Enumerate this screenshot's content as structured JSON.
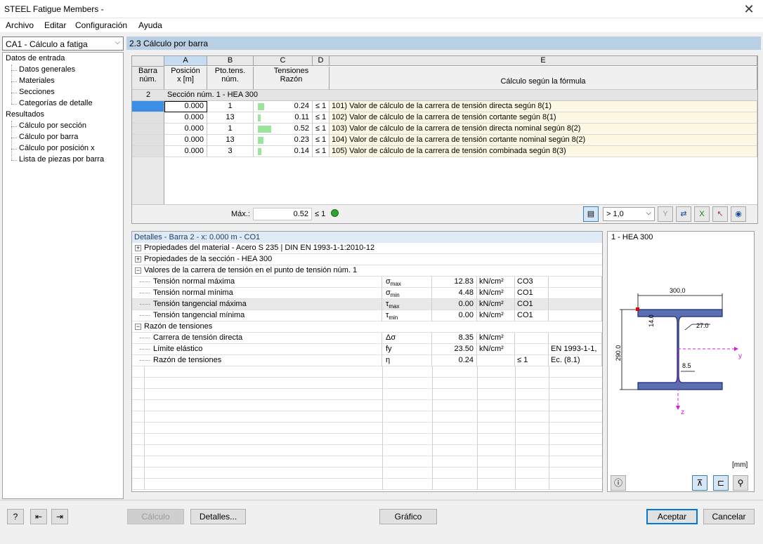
{
  "window": {
    "title": "STEEL Fatigue Members -",
    "close": "✕"
  },
  "menu": [
    "Archivo",
    "Editar",
    "Configuración",
    "Ayuda"
  ],
  "case_select": "CA1 - Cálculo a fatiga",
  "tree": {
    "input_group": "Datos de entrada",
    "input_items": [
      "Datos generales",
      "Materiales",
      "Secciones",
      "Categorías de detalle"
    ],
    "results_group": "Resultados",
    "results_items": [
      "Cálculo por sección",
      "Cálculo por barra",
      "Cálculo por posición x",
      "Lista de piezas por barra"
    ]
  },
  "panel_title": "2.3 Cálculo por barra",
  "grid": {
    "col_letters": [
      "A",
      "B",
      "C",
      "D",
      "E"
    ],
    "h_barra": [
      "Barra",
      "núm."
    ],
    "h_a": [
      "Posición",
      "x [m]"
    ],
    "h_b": [
      "Pto.tens.",
      "núm."
    ],
    "h_c": [
      "Tensiones",
      "Razón"
    ],
    "h_e": "Cálculo según la fórmula",
    "group_bar": "2",
    "group_label": "Sección núm.  1 - HEA 300",
    "rows": [
      {
        "x": "0.000",
        "pt": "1",
        "ratio": "0.24",
        "ratio_val": 0.24,
        "le": "≤ 1",
        "formula": "101) Valor de cálculo de la carrera de tensión directa según 8(1)"
      },
      {
        "x": "0.000",
        "pt": "13",
        "ratio": "0.11",
        "ratio_val": 0.11,
        "le": "≤ 1",
        "formula": "102) Valor de cálculo de la carrera de tensión cortante según 8(1)"
      },
      {
        "x": "0.000",
        "pt": "1",
        "ratio": "0.52",
        "ratio_val": 0.52,
        "le": "≤ 1",
        "formula": "103) Valor de cálculo de la carrera de tensión directa nominal según 8(2)"
      },
      {
        "x": "0.000",
        "pt": "13",
        "ratio": "0.23",
        "ratio_val": 0.23,
        "le": "≤ 1",
        "formula": "104) Valor de cálculo de la carrera de tensión cortante nominal según 8(2)"
      },
      {
        "x": "0.000",
        "pt": "3",
        "ratio": "0.14",
        "ratio_val": 0.14,
        "le": "≤ 1",
        "formula": "105) Valor de cálculo de la carrera de tensión combinada según 8(3)"
      }
    ],
    "max_label": "Máx.:",
    "max_value": "0.52",
    "max_le": "≤ 1",
    "filter_value": "> 1,0"
  },
  "details": {
    "title": "Detalles - Barra 2 - x: 0.000 m - CO1",
    "sec1": "Propiedades del material - Acero S 235 | DIN EN 1993-1-1:2010-12",
    "sec2": "Propiedades de la sección  -  HEA 300",
    "sec3": "Valores de la carrera de tensión en el punto de tensión núm. 1",
    "stress_rows": [
      {
        "name": "Tensión normal máxima",
        "sym": "σ",
        "sub": "max",
        "val": "12.83",
        "unit": "kN/cm²",
        "co": "CO3"
      },
      {
        "name": "Tensión normal mínima",
        "sym": "σ",
        "sub": "min",
        "val": "4.48",
        "unit": "kN/cm²",
        "co": "CO1"
      },
      {
        "name": "Tensión tangencial máxima",
        "sym": "τ",
        "sub": "max",
        "val": "0.00",
        "unit": "kN/cm²",
        "co": "CO1"
      },
      {
        "name": "Tensión tangencial mínima",
        "sym": "τ",
        "sub": "min",
        "val": "0.00",
        "unit": "kN/cm²",
        "co": "CO1"
      }
    ],
    "sec4": "Razón de tensiones",
    "ratio_rows": [
      {
        "name": "Carrera de tensión directa",
        "sym": "Δσ",
        "val": "8.35",
        "unit": "kN/cm²",
        "le": "",
        "ref": ""
      },
      {
        "name": "Límite elástico",
        "sym": "fy",
        "val": "23.50",
        "unit": "kN/cm²",
        "le": "",
        "ref": "EN 1993-1-1,"
      },
      {
        "name": "Razón de tensiones",
        "sym": "η",
        "val": "0.24",
        "unit": "",
        "le": "≤ 1",
        "ref": "Ec. (8.1)"
      }
    ]
  },
  "section_view": {
    "title": "1 - HEA 300",
    "dim_b": "300.0",
    "dim_h": "290.0",
    "dim_tf": "14.0",
    "dim_r": "27.0",
    "dim_tw": "8.5",
    "axis_y": "y",
    "axis_z": "z",
    "units": "[mm]"
  },
  "buttons": {
    "calc": "Cálculo",
    "details": "Detalles...",
    "graphic": "Gráfico",
    "ok": "Aceptar",
    "cancel": "Cancelar"
  }
}
